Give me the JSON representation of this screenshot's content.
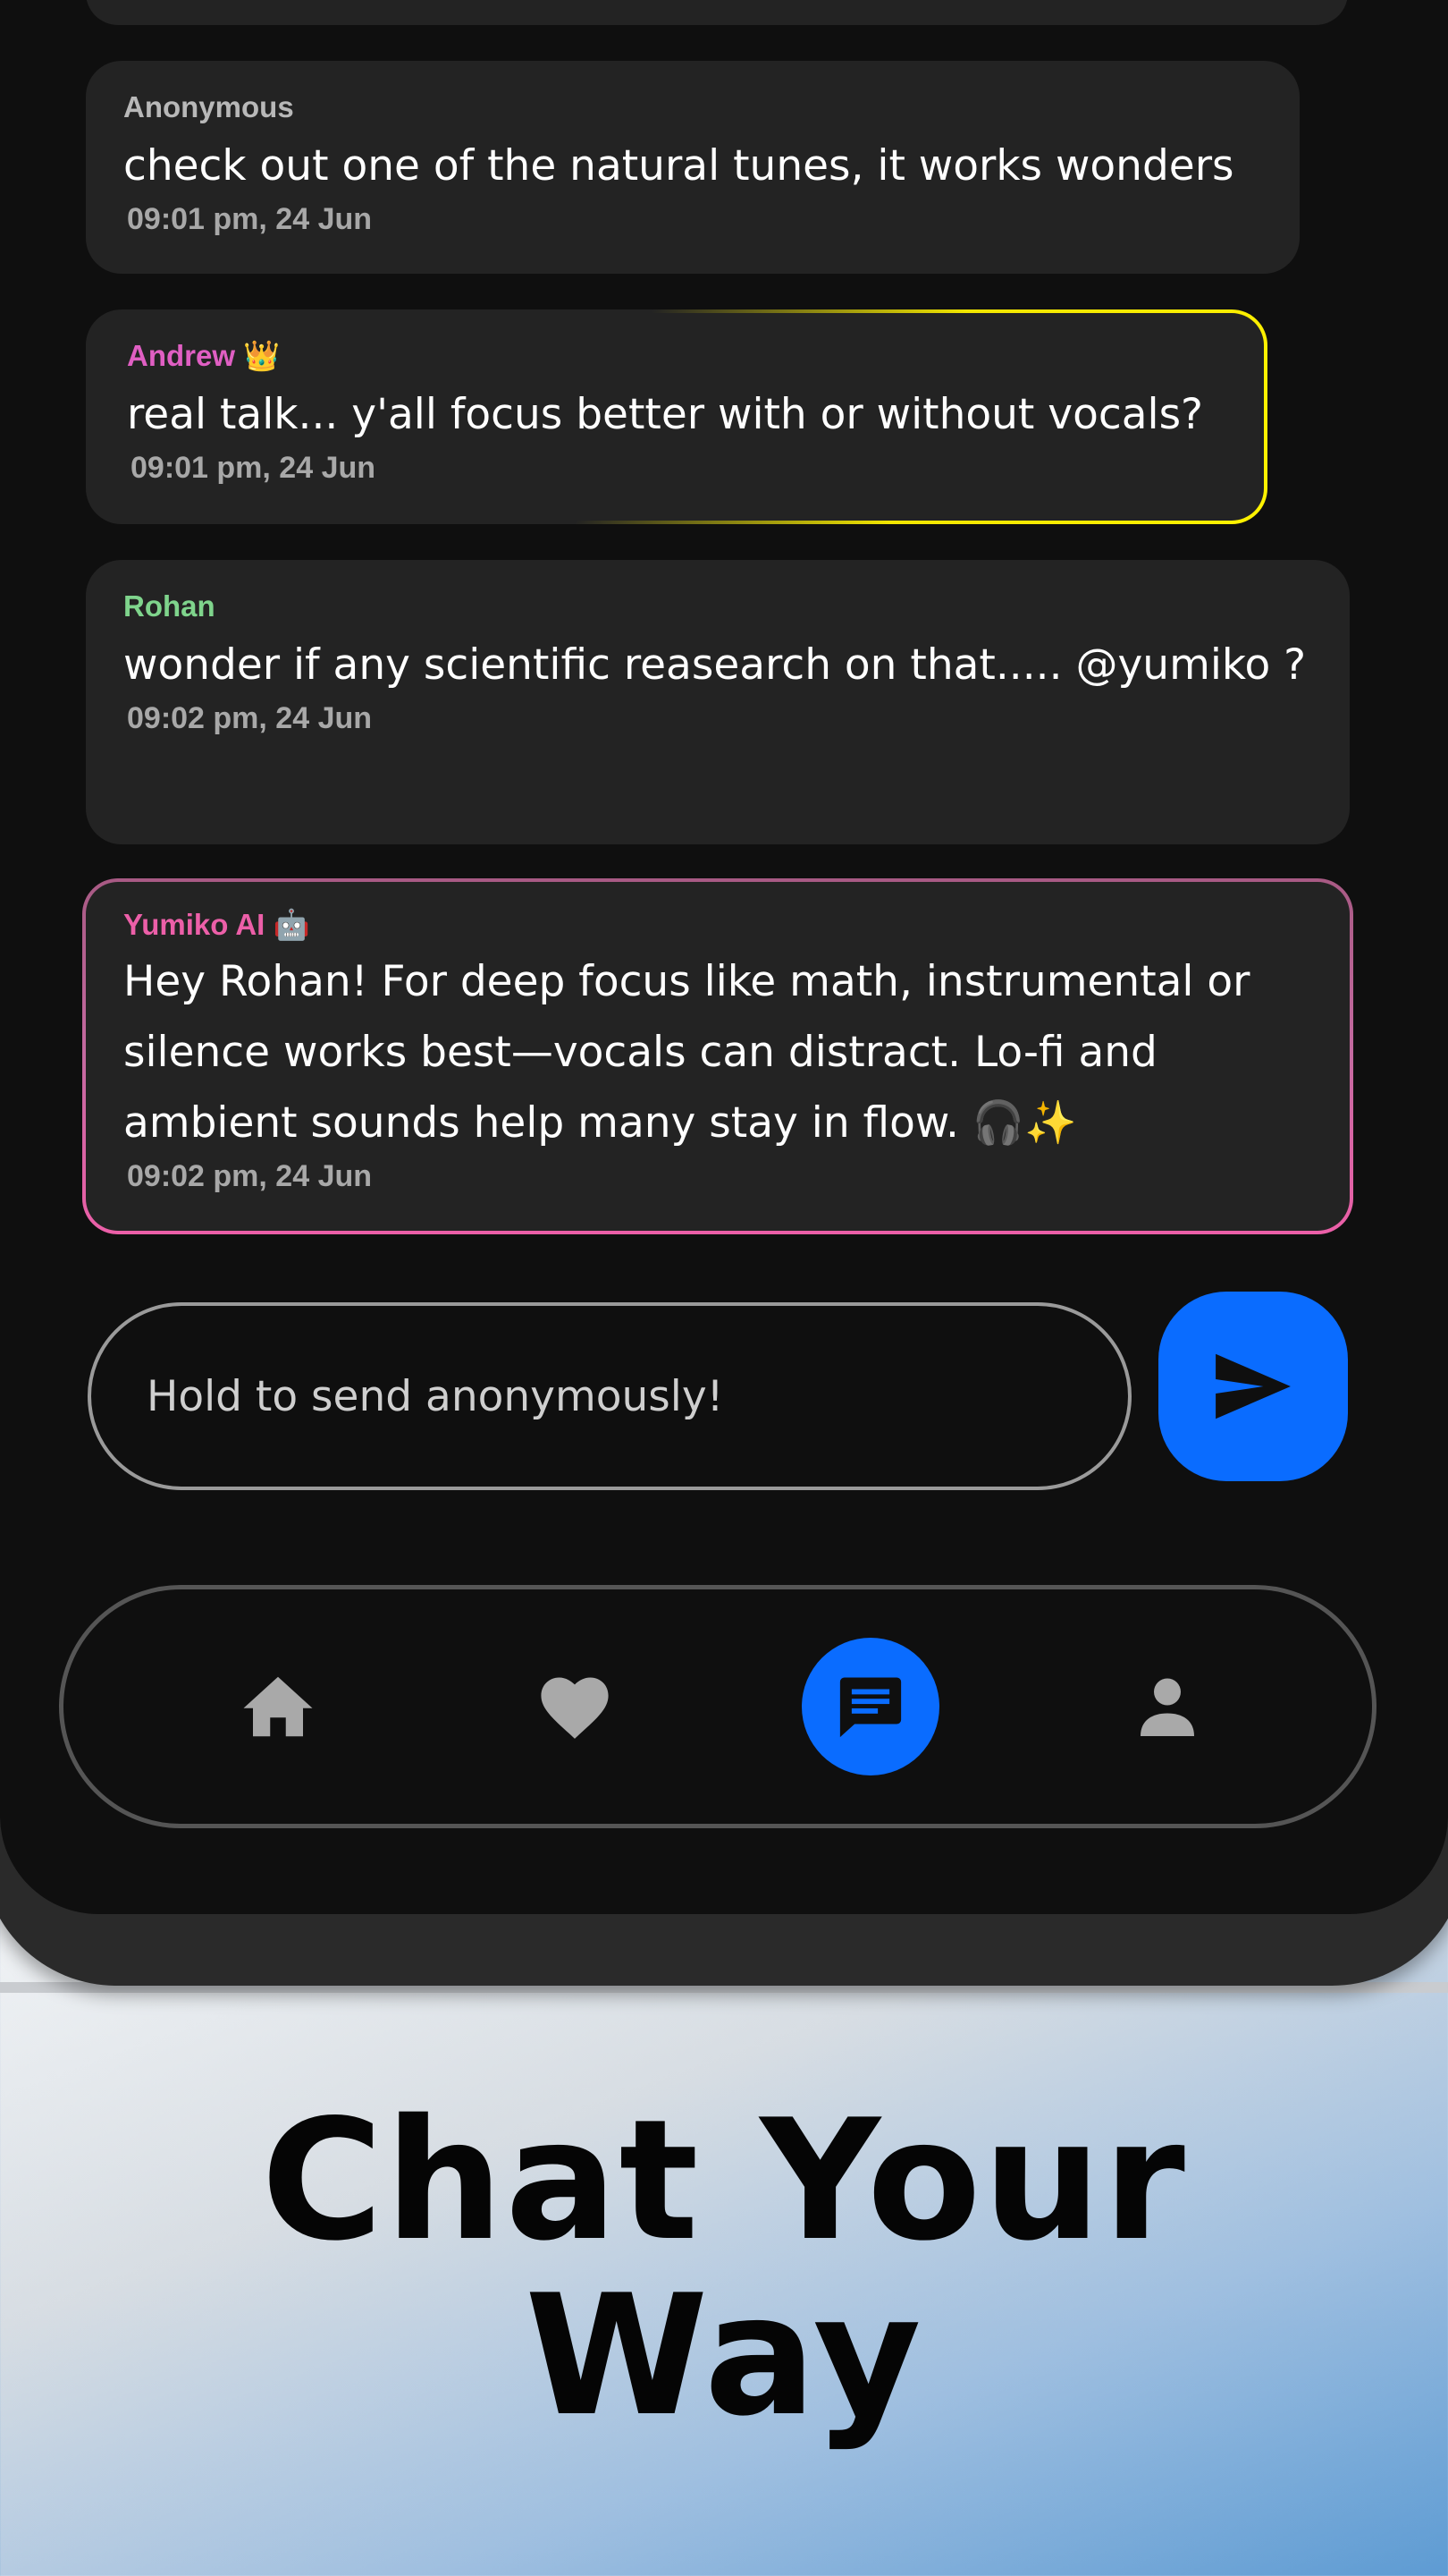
{
  "messages": [
    {
      "author": "Anonymous",
      "text": "check out one of the natural tunes, it works wonders",
      "time": "09:01 pm, 24 Jun"
    },
    {
      "author": "Andrew 👑",
      "text": "real talk... y'all focus better with or without vocals?",
      "time": "09:01 pm, 24 Jun"
    },
    {
      "author": "Rohan",
      "text": "wonder if any scientific reasearch on that..... @yumiko ?",
      "time": "09:02 pm, 24 Jun"
    },
    {
      "author": "Yumiko AI 🤖",
      "text": "Hey Rohan! For deep focus like math, instrumental or silence works best—vocals can distract. Lo-fi and ambient sounds help many stay in flow. 🎧✨",
      "time": "09:02 pm, 24 Jun"
    }
  ],
  "composer": {
    "placeholder": "Hold to send anonymously!"
  },
  "nav": {
    "items": [
      "home-icon",
      "heart-icon",
      "chat-icon",
      "profile-icon"
    ],
    "active": "chat-icon"
  },
  "headline": {
    "line1": "Chat Your",
    "line2": "Way"
  },
  "colors": {
    "accent": "#0a6cff",
    "author_anonymous": "#b8b8b8",
    "author_andrew": "#e05fc3",
    "author_rohan": "#7fd48c",
    "author_yumiko": "#ec5fa8",
    "andrew_border": "#fff200",
    "yumiko_border": "#ec5fa8"
  }
}
